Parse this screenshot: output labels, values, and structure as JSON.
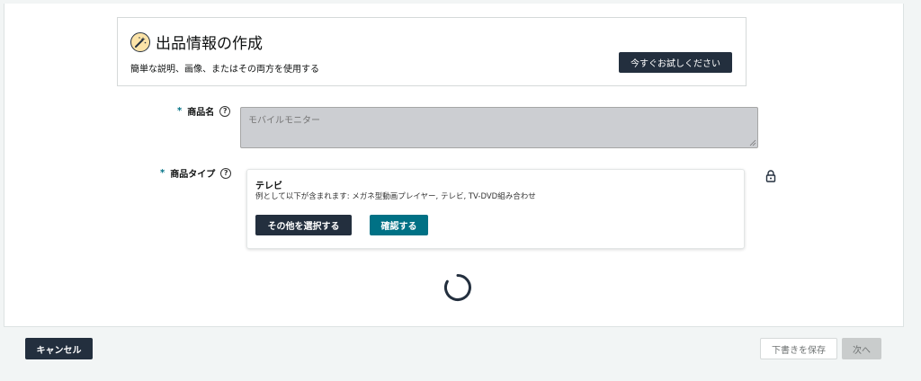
{
  "ai_box": {
    "icon": "magic-wand-icon",
    "title": "出品情報の作成",
    "subtitle": "簡単な説明、画像、またはその両方を使用する",
    "try_button": "今すぐお試しください"
  },
  "product_name": {
    "required_mark": "*",
    "label": "商品名",
    "help_icon": "help-circle-icon",
    "help_glyph": "?",
    "placeholder": "モバイルモニター"
  },
  "product_type": {
    "required_mark": "*",
    "label": "商品タイプ",
    "help_icon": "help-circle-icon",
    "help_glyph": "?",
    "selected": "テレビ",
    "description": "例として以下が含まれます: メガネ型動画プレイヤー, テレビ, TV-DVD組み合わせ",
    "select_other_button": "その他を選択する",
    "confirm_button": "確認する",
    "lock_icon": "lock-icon"
  },
  "loading_icon": "loading-spinner-icon",
  "footer": {
    "cancel_button": "キャンセル",
    "save_draft_button": "下書きを保存",
    "next_button": "次へ"
  },
  "colors": {
    "dark": "#232f3e",
    "teal": "#007185",
    "input_bg": "#ccced2",
    "page_bg": "#f2f5f5"
  }
}
